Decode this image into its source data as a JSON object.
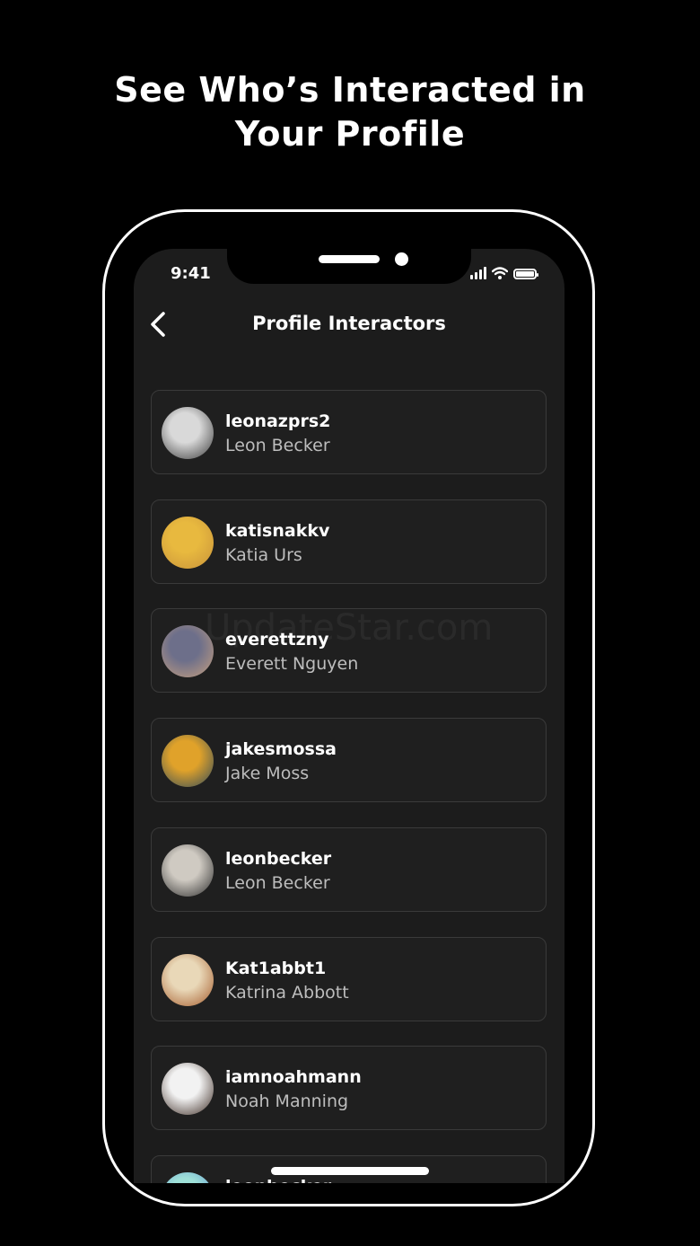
{
  "headline": {
    "line1": "See Who’s Interacted in",
    "line2": "Your Profile"
  },
  "status_bar": {
    "time": "9:41",
    "icons": [
      "cellular-signal-icon",
      "wifi-icon",
      "battery-icon"
    ]
  },
  "nav": {
    "back_icon": "chevron-left-icon",
    "title": "Profile Interactors"
  },
  "interactors": [
    {
      "username": "leonazprs2",
      "name": "Leon Becker",
      "avatar_colors": [
        "#d9d9d9",
        "#3a3a3a"
      ]
    },
    {
      "username": "katisnakkv",
      "name": "Katia Urs",
      "avatar_colors": [
        "#e8b93f",
        "#c8923a"
      ]
    },
    {
      "username": "everettzny",
      "name": "Everett Nguyen",
      "avatar_colors": [
        "#6d6f8a",
        "#c7a07f"
      ]
    },
    {
      "username": "jakesmossa",
      "name": "Jake Moss",
      "avatar_colors": [
        "#e0a22a",
        "#2f4a5a"
      ]
    },
    {
      "username": "leonbecker",
      "name": "Leon Becker",
      "avatar_colors": [
        "#cfcac2",
        "#2b2b2b"
      ]
    },
    {
      "username": "Kat1abbt1",
      "name": "Katrina Abbott",
      "avatar_colors": [
        "#e9d8b8",
        "#a45a2a"
      ]
    },
    {
      "username": "iamnoahmann",
      "name": "Noah Manning",
      "avatar_colors": [
        "#f2f2f2",
        "#3b2a22"
      ]
    },
    {
      "username": "leonbecker",
      "name": "",
      "avatar_colors": [
        "#9fe0d8",
        "#5a8fd0"
      ]
    }
  ],
  "watermark": "UpdateStar.com"
}
